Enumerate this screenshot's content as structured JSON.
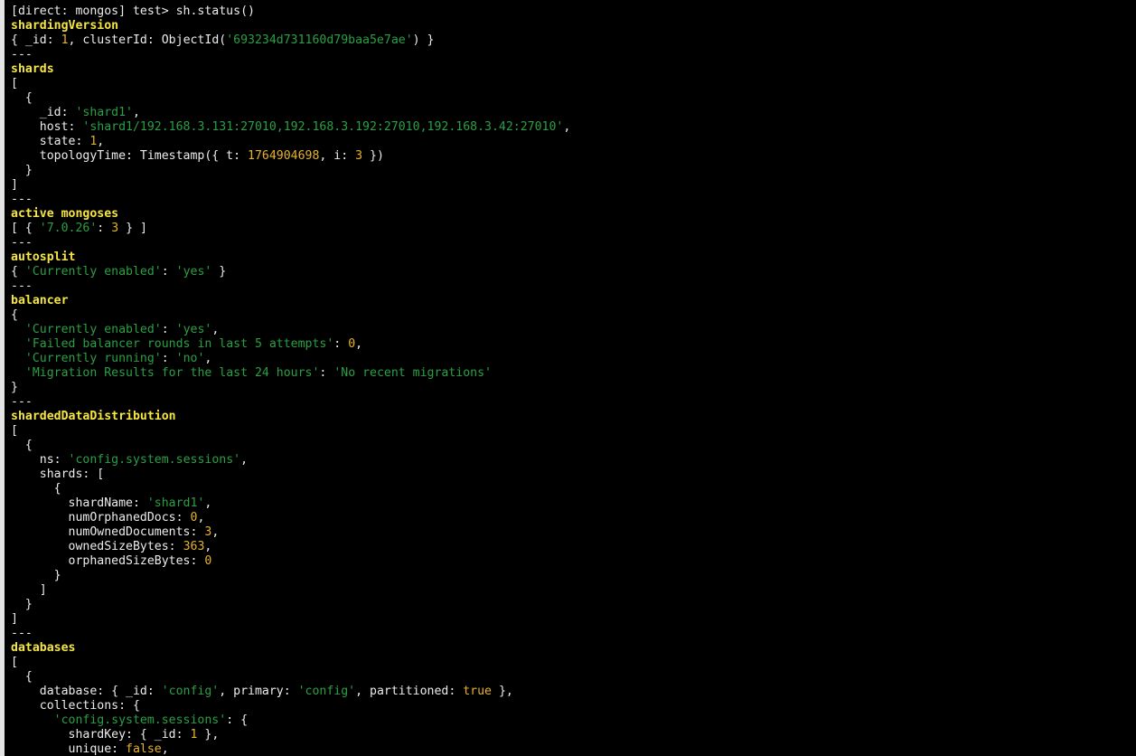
{
  "terminal": {
    "colors": {
      "background": "#000000",
      "text": "#ececec",
      "heading": "#f5e641",
      "string": "#2b9f44",
      "number": "#e5b32c"
    },
    "lines": [
      [
        [
          "prompt",
          "[direct: mongos] test> sh.status()"
        ]
      ],
      [
        [
          "hd",
          "shardingVersion"
        ]
      ],
      [
        [
          "punc",
          "{ _id: "
        ],
        [
          "num",
          "1"
        ],
        [
          "punc",
          ", clusterId: ObjectId("
        ],
        [
          "str",
          "'693234d731160d79baa5e7ae'"
        ],
        [
          "punc",
          ") }"
        ]
      ],
      [
        [
          "punc",
          "---"
        ]
      ],
      [
        [
          "hd",
          "shards"
        ]
      ],
      [
        [
          "punc",
          "["
        ]
      ],
      [
        [
          "punc",
          "  {"
        ]
      ],
      [
        [
          "key",
          "    _id: "
        ],
        [
          "str",
          "'shard1'"
        ],
        [
          "punc",
          ","
        ]
      ],
      [
        [
          "key",
          "    host: "
        ],
        [
          "str",
          "'shard1/192.168.3.131:27010,192.168.3.192:27010,192.168.3.42:27010'"
        ],
        [
          "punc",
          ","
        ]
      ],
      [
        [
          "key",
          "    state: "
        ],
        [
          "num",
          "1"
        ],
        [
          "punc",
          ","
        ]
      ],
      [
        [
          "key",
          "    topologyTime: Timestamp({ t: "
        ],
        [
          "num",
          "1764904698"
        ],
        [
          "punc",
          ", i: "
        ],
        [
          "num",
          "3"
        ],
        [
          "punc",
          " })"
        ]
      ],
      [
        [
          "punc",
          "  }"
        ]
      ],
      [
        [
          "punc",
          "]"
        ]
      ],
      [
        [
          "punc",
          "---"
        ]
      ],
      [
        [
          "hd",
          "active mongoses"
        ]
      ],
      [
        [
          "punc",
          "[ { "
        ],
        [
          "str",
          "'7.0.26'"
        ],
        [
          "punc",
          ": "
        ],
        [
          "num",
          "3"
        ],
        [
          "punc",
          " } ]"
        ]
      ],
      [
        [
          "punc",
          "---"
        ]
      ],
      [
        [
          "hd",
          "autosplit"
        ]
      ],
      [
        [
          "punc",
          "{ "
        ],
        [
          "str",
          "'Currently enabled'"
        ],
        [
          "punc",
          ": "
        ],
        [
          "str",
          "'yes'"
        ],
        [
          "punc",
          " }"
        ]
      ],
      [
        [
          "punc",
          "---"
        ]
      ],
      [
        [
          "hd",
          "balancer"
        ]
      ],
      [
        [
          "punc",
          "{"
        ]
      ],
      [
        [
          "punc",
          "  "
        ],
        [
          "str",
          "'Currently enabled'"
        ],
        [
          "punc",
          ": "
        ],
        [
          "str",
          "'yes'"
        ],
        [
          "punc",
          ","
        ]
      ],
      [
        [
          "punc",
          "  "
        ],
        [
          "str",
          "'Failed balancer rounds in last 5 attempts'"
        ],
        [
          "punc",
          ": "
        ],
        [
          "num",
          "0"
        ],
        [
          "punc",
          ","
        ]
      ],
      [
        [
          "punc",
          "  "
        ],
        [
          "str",
          "'Currently running'"
        ],
        [
          "punc",
          ": "
        ],
        [
          "str",
          "'no'"
        ],
        [
          "punc",
          ","
        ]
      ],
      [
        [
          "punc",
          "  "
        ],
        [
          "str",
          "'Migration Results for the last 24 hours'"
        ],
        [
          "punc",
          ": "
        ],
        [
          "str",
          "'No recent migrations'"
        ]
      ],
      [
        [
          "punc",
          "}"
        ]
      ],
      [
        [
          "punc",
          "---"
        ]
      ],
      [
        [
          "hd",
          "shardedDataDistribution"
        ]
      ],
      [
        [
          "punc",
          "["
        ]
      ],
      [
        [
          "punc",
          "  {"
        ]
      ],
      [
        [
          "key",
          "    ns: "
        ],
        [
          "str",
          "'config.system.sessions'"
        ],
        [
          "punc",
          ","
        ]
      ],
      [
        [
          "key",
          "    shards: ["
        ]
      ],
      [
        [
          "punc",
          "      {"
        ]
      ],
      [
        [
          "key",
          "        shardName: "
        ],
        [
          "str",
          "'shard1'"
        ],
        [
          "punc",
          ","
        ]
      ],
      [
        [
          "key",
          "        numOrphanedDocs: "
        ],
        [
          "num",
          "0"
        ],
        [
          "punc",
          ","
        ]
      ],
      [
        [
          "key",
          "        numOwnedDocuments: "
        ],
        [
          "num",
          "3"
        ],
        [
          "punc",
          ","
        ]
      ],
      [
        [
          "key",
          "        ownedSizeBytes: "
        ],
        [
          "num",
          "363"
        ],
        [
          "punc",
          ","
        ]
      ],
      [
        [
          "key",
          "        orphanedSizeBytes: "
        ],
        [
          "num",
          "0"
        ]
      ],
      [
        [
          "punc",
          "      }"
        ]
      ],
      [
        [
          "punc",
          "    ]"
        ]
      ],
      [
        [
          "punc",
          "  }"
        ]
      ],
      [
        [
          "punc",
          "]"
        ]
      ],
      [
        [
          "punc",
          "---"
        ]
      ],
      [
        [
          "hd",
          "databases"
        ]
      ],
      [
        [
          "punc",
          "["
        ]
      ],
      [
        [
          "punc",
          "  {"
        ]
      ],
      [
        [
          "key",
          "    database: { _id: "
        ],
        [
          "str",
          "'config'"
        ],
        [
          "punc",
          ", primary: "
        ],
        [
          "str",
          "'config'"
        ],
        [
          "punc",
          ", partitioned: "
        ],
        [
          "bool",
          "true"
        ],
        [
          "punc",
          " },"
        ]
      ],
      [
        [
          "key",
          "    collections: {"
        ]
      ],
      [
        [
          "punc",
          "      "
        ],
        [
          "str",
          "'config.system.sessions'"
        ],
        [
          "punc",
          ": {"
        ]
      ],
      [
        [
          "key",
          "        shardKey: { _id: "
        ],
        [
          "num",
          "1"
        ],
        [
          "punc",
          " },"
        ]
      ],
      [
        [
          "key",
          "        unique: "
        ],
        [
          "bool",
          "false"
        ],
        [
          "punc",
          ","
        ]
      ]
    ]
  }
}
